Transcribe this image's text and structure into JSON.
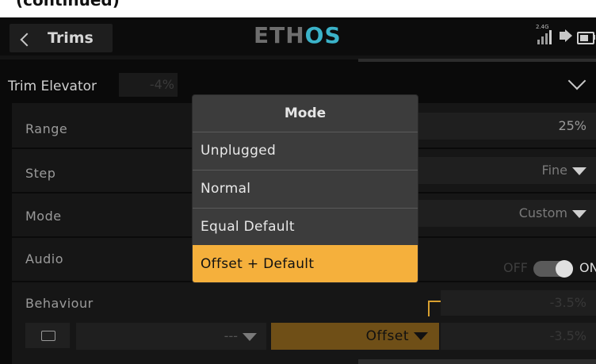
{
  "caption": "(continued)",
  "header": {
    "title": "Trims",
    "logo_left": "ETH",
    "logo_right": "OS",
    "signal_label": "2.4G"
  },
  "trim_row": {
    "label": "Trim Elevator",
    "value": "-4%"
  },
  "rows": {
    "range": {
      "label": "Range",
      "value": "25%"
    },
    "step": {
      "label": "Step",
      "value": "Fine"
    },
    "mode": {
      "label": "Mode",
      "value": "Custom"
    },
    "audio": {
      "label": "Audio",
      "off": "OFF",
      "on": "ON",
      "state": "on"
    },
    "behaviour": {
      "label": "Behaviour",
      "value_top": "-3.5%",
      "switch_value": "---",
      "mode_value": "Offset",
      "value_bottom": "-3.5%"
    }
  },
  "modal": {
    "title": "Mode",
    "options": [
      "Unplugged",
      "Normal",
      "Equal Default",
      "Offset + Default"
    ],
    "selected": "Offset + Default"
  },
  "colors": {
    "accent": "#f5b03c",
    "logo_highlight": "#3bb3c9",
    "background": "#0a0a0a"
  }
}
